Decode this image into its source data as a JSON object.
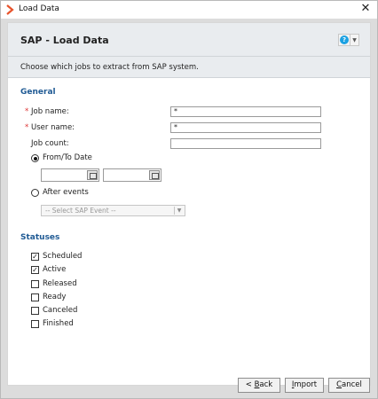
{
  "window": {
    "title": "Load Data",
    "close_glyph": "✕",
    "accent": "#e8532b"
  },
  "header": {
    "title": "SAP - Load Data",
    "help_glyph": "?",
    "caret_glyph": "▼"
  },
  "description": "Choose which jobs to extract from SAP system.",
  "general": {
    "title": "General",
    "job_name": {
      "label": "Job name:",
      "value": "*",
      "required_mark": "*"
    },
    "user_name": {
      "label": "User name:",
      "value": "*",
      "required_mark": "*"
    },
    "job_count": {
      "label": "Job count:",
      "value": ""
    },
    "from_to_date": {
      "label": "From/To Date",
      "selected": true
    },
    "after_events": {
      "label": "After events",
      "selected": false
    },
    "event_select": {
      "value": "-- Select SAP Event --",
      "caret": "▼"
    }
  },
  "statuses": {
    "title": "Statuses",
    "items": [
      {
        "label": "Scheduled",
        "checked": "✓"
      },
      {
        "label": "Active",
        "checked": "✓"
      },
      {
        "label": "Released",
        "checked": ""
      },
      {
        "label": "Ready",
        "checked": ""
      },
      {
        "label": "Canceled",
        "checked": ""
      },
      {
        "label": "Finished",
        "checked": ""
      }
    ]
  },
  "footer": {
    "back": {
      "prefix": "< ",
      "accel": "B",
      "rest": "ack"
    },
    "import": {
      "accel": "I",
      "rest": "mport"
    },
    "cancel": {
      "accel": "C",
      "rest": "ancel"
    }
  }
}
